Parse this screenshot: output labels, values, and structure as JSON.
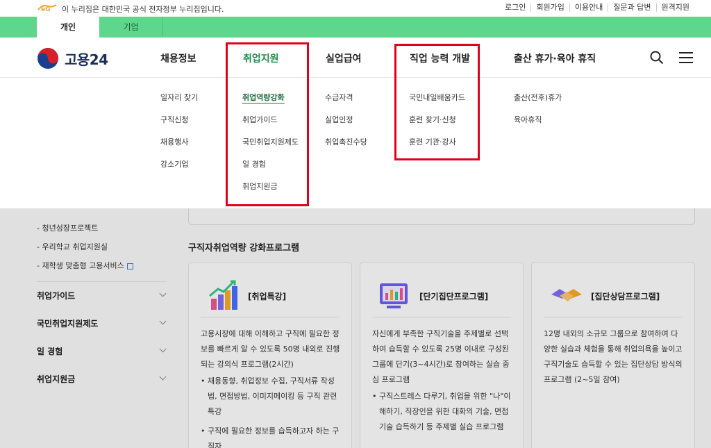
{
  "govbar": {
    "text": "이 누리집은 대한민국 공식 전자정부 누리집입니다.",
    "links": [
      "로그인",
      "회원가입",
      "이용안내",
      "질문과 답변",
      "원격지원"
    ]
  },
  "tabs": {
    "personal": "개인",
    "corp": "기업"
  },
  "logo": {
    "text": "고용24"
  },
  "gnb": [
    "채용정보",
    "취업지원",
    "실업급여",
    "직업 능력 개발",
    "출산 휴가·육아 휴직"
  ],
  "mega": {
    "recruit": [
      "일자리 찾기",
      "구직신청",
      "채용행사",
      "강소기업"
    ],
    "support": [
      "취업역량강화",
      "취업가이드",
      "국민취업지원제도",
      "일 경험",
      "취업지원금"
    ],
    "benefit": [
      "수급자격",
      "실업인정",
      "취업촉진수당"
    ],
    "training": [
      "국민내일배움카드",
      "훈련 찾기·신청",
      "훈련 기관·강사"
    ],
    "leave": [
      "출산(전후)휴가",
      "육아휴직"
    ]
  },
  "lnb": {
    "subs": [
      "- 청년성장프로젝트",
      "- 우리학교 취업지원실",
      "- 재학생 맞춤형 고용서비스"
    ],
    "items": [
      "취업가이드",
      "국민취업지원제도",
      "일 경험",
      "취업지원금"
    ]
  },
  "section_title": "구직자취업역량 강화프로그램",
  "cards": [
    {
      "title": "[취업특강]",
      "desc": "고용시장에 대해 이해하고 구직에 필요한 정보를 빠르게 알 수 있도록 50명 내외로 진행되는 강의식 프로그램(2시간)",
      "bullets": [
        "채용동향, 취업정보 수집, 구직서류 작성법, 면접방법, 이미지메이킹 등 구직 관련 특강",
        "구직에 필요한 정보를 습득하고자 하는 구직자"
      ]
    },
    {
      "title": "[단기집단프로그램]",
      "desc": "자신에게 부족한 구직기술을 주제별로 선택하여 습득할 수 있도록 25명 이내로 구성된 그룹에 단기(3~4시간)로 참여하는 실습 중심 프로그램",
      "bullets": [
        "구직스트레스 다루기, 취업을 위한 \"나\"이해하기, 직장인을 위한 대화의 기술, 면접기술 습득하기 등 주제별 실습 프로그램"
      ]
    },
    {
      "title": "[집단상담프로그램]",
      "desc": "12명 내외의 소규모 그룹으로 참여하여 다양한 실습과 체험을 통해 취업의욕을 높이고 구직기술도 습득할 수 있는 집단상담 방식의 프로그램 (2~5일 참여)",
      "bullets": []
    }
  ],
  "colors": {
    "green": "#5ed78c",
    "active": "#1f8f4d",
    "highlight": "#e0001b"
  }
}
